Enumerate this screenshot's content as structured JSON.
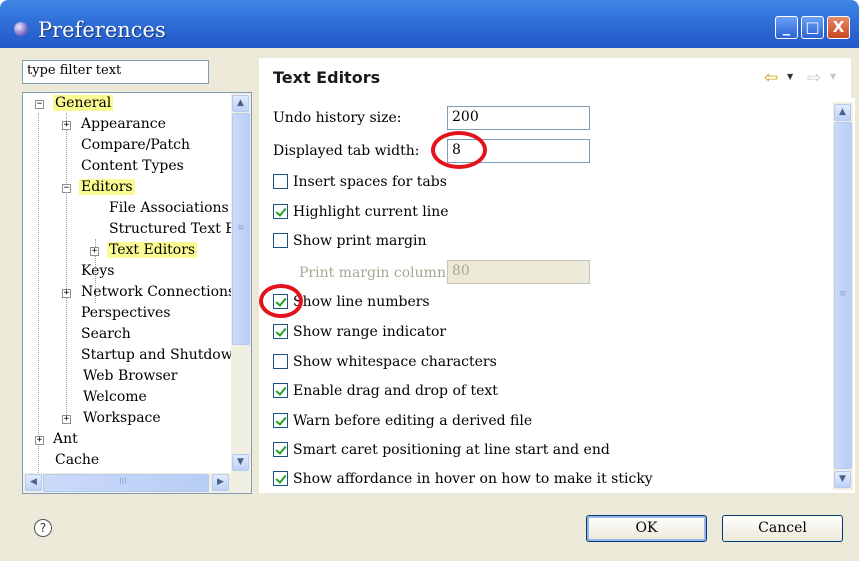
{
  "window": {
    "title": "Preferences",
    "minimize": "_",
    "maximize": "□",
    "close": "X"
  },
  "filter": {
    "value": "type filter text"
  },
  "tree": {
    "items": [
      {
        "label": "General",
        "expander": "−",
        "highlight": true
      },
      {
        "label": "Appearance",
        "expander": "+"
      },
      {
        "label": "Compare/Patch"
      },
      {
        "label": "Content Types"
      },
      {
        "label": "Editors",
        "expander": "−",
        "highlight": true
      },
      {
        "label": "File Associations"
      },
      {
        "label": "Structured Text Ed"
      },
      {
        "label": "Text Editors",
        "expander": "+",
        "highlight": true
      },
      {
        "label": "Keys"
      },
      {
        "label": "Network Connections",
        "expander": "+"
      },
      {
        "label": "Perspectives"
      },
      {
        "label": "Search"
      },
      {
        "label": "Startup and Shutdown"
      },
      {
        "label": "Web Browser"
      },
      {
        "label": "Welcome"
      },
      {
        "label": "Workspace",
        "expander": "+"
      },
      {
        "label": "Ant",
        "expander": "+"
      },
      {
        "label": "Cache"
      }
    ],
    "hscroll_grip": "III"
  },
  "page": {
    "title": "Text Editors",
    "nav_back": "⇦",
    "nav_fwd": "⇨",
    "dropdown": "▼"
  },
  "fields": {
    "undo_label": "Undo history size:",
    "undo_value": "200",
    "tab_label": "Displayed tab width:",
    "tab_value": "8",
    "margin_label": "Print margin column:",
    "margin_value": "80"
  },
  "checks": [
    {
      "label": "Insert spaces for tabs",
      "checked": false
    },
    {
      "label": "Highlight current line",
      "checked": true
    },
    {
      "label": "Show print margin",
      "checked": false
    },
    {
      "label": "Show line numbers",
      "checked": true
    },
    {
      "label": "Show range indicator",
      "checked": true
    },
    {
      "label": "Show whitespace characters",
      "checked": false
    },
    {
      "label": "Enable drag and drop of text",
      "checked": true
    },
    {
      "label": "Warn before editing a derived file",
      "checked": true
    },
    {
      "label": "Smart caret positioning at line start and end",
      "checked": true
    },
    {
      "label": "Show affordance in hover on how to make it sticky",
      "checked": true
    }
  ],
  "footer": {
    "help": "?",
    "ok": "OK",
    "cancel": "Cancel"
  },
  "colors": {
    "titlebar": "#2f6fd8",
    "highlight": "#fbfb94",
    "annotation": "#e3131b",
    "dialog": "#ece9d8"
  }
}
